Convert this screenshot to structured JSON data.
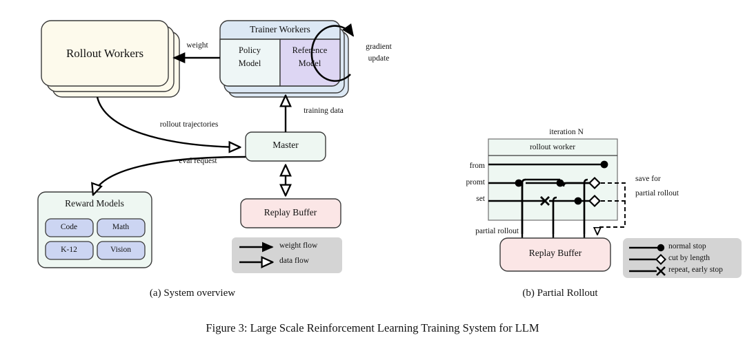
{
  "figure": {
    "caption": "Figure 3: Large Scale Reinforcement Learning Training System for LLM",
    "subcaption_a": "(a) System overview",
    "subcaption_b": "(b) Partial Rollout"
  },
  "colors": {
    "cream": "#fdfaec",
    "blue_header": "#dce8f4",
    "blue_body": "#eef6f6",
    "purple": "#ddd6f3",
    "mint": "#eef7f2",
    "pink": "#fbe6e6",
    "periwinkle": "#ccd5f2",
    "legend_gray": "#d4d4d4",
    "stroke": "#3a3a3a",
    "line": "#000000"
  },
  "panel_a": {
    "rollout_workers": {
      "label": "Rollout Workers",
      "stack": 3
    },
    "trainer_workers": {
      "label": "Trainer Workers",
      "stack": 3,
      "sub_boxes": [
        {
          "line1": "Policy",
          "line2": "Model"
        },
        {
          "line1": "Reference",
          "line2": "Model"
        }
      ]
    },
    "gradient_update": {
      "line1": "gradient",
      "line2": "update"
    },
    "master": {
      "label": "Master"
    },
    "replay_buffer": {
      "label": "Replay Buffer"
    },
    "reward_models": {
      "label": "Reward Models",
      "items": [
        "Code",
        "Math",
        "K-12",
        "Vision"
      ]
    },
    "edges": [
      {
        "name": "weight",
        "label": "weight",
        "kind": "weight flow"
      },
      {
        "name": "rollout-trajectories",
        "label": "rollout trajectories",
        "kind": "data flow"
      },
      {
        "name": "eval-request",
        "label": "eval request",
        "kind": "data flow"
      },
      {
        "name": "training-data",
        "label": "training data",
        "kind": "data flow"
      }
    ],
    "legend": {
      "items": [
        {
          "label": "weight flow",
          "arrow": "solid"
        },
        {
          "label": "data flow",
          "arrow": "hollow"
        }
      ]
    }
  },
  "panel_b": {
    "iteration_label": "iteration N",
    "worker_label": "rollout worker",
    "left_label_lines": [
      "from",
      "promt",
      "set"
    ],
    "partial_rollout_label": "partial rollout",
    "save_label_lines": [
      "save for",
      "partial rollout"
    ],
    "replay_buffer": {
      "label": "Replay Buffer"
    },
    "legend": {
      "items": [
        {
          "label": "normal stop",
          "marker": "dot"
        },
        {
          "label": "cut by length",
          "marker": "diamond"
        },
        {
          "label": "repeat, early stop",
          "marker": "cross"
        }
      ]
    }
  }
}
